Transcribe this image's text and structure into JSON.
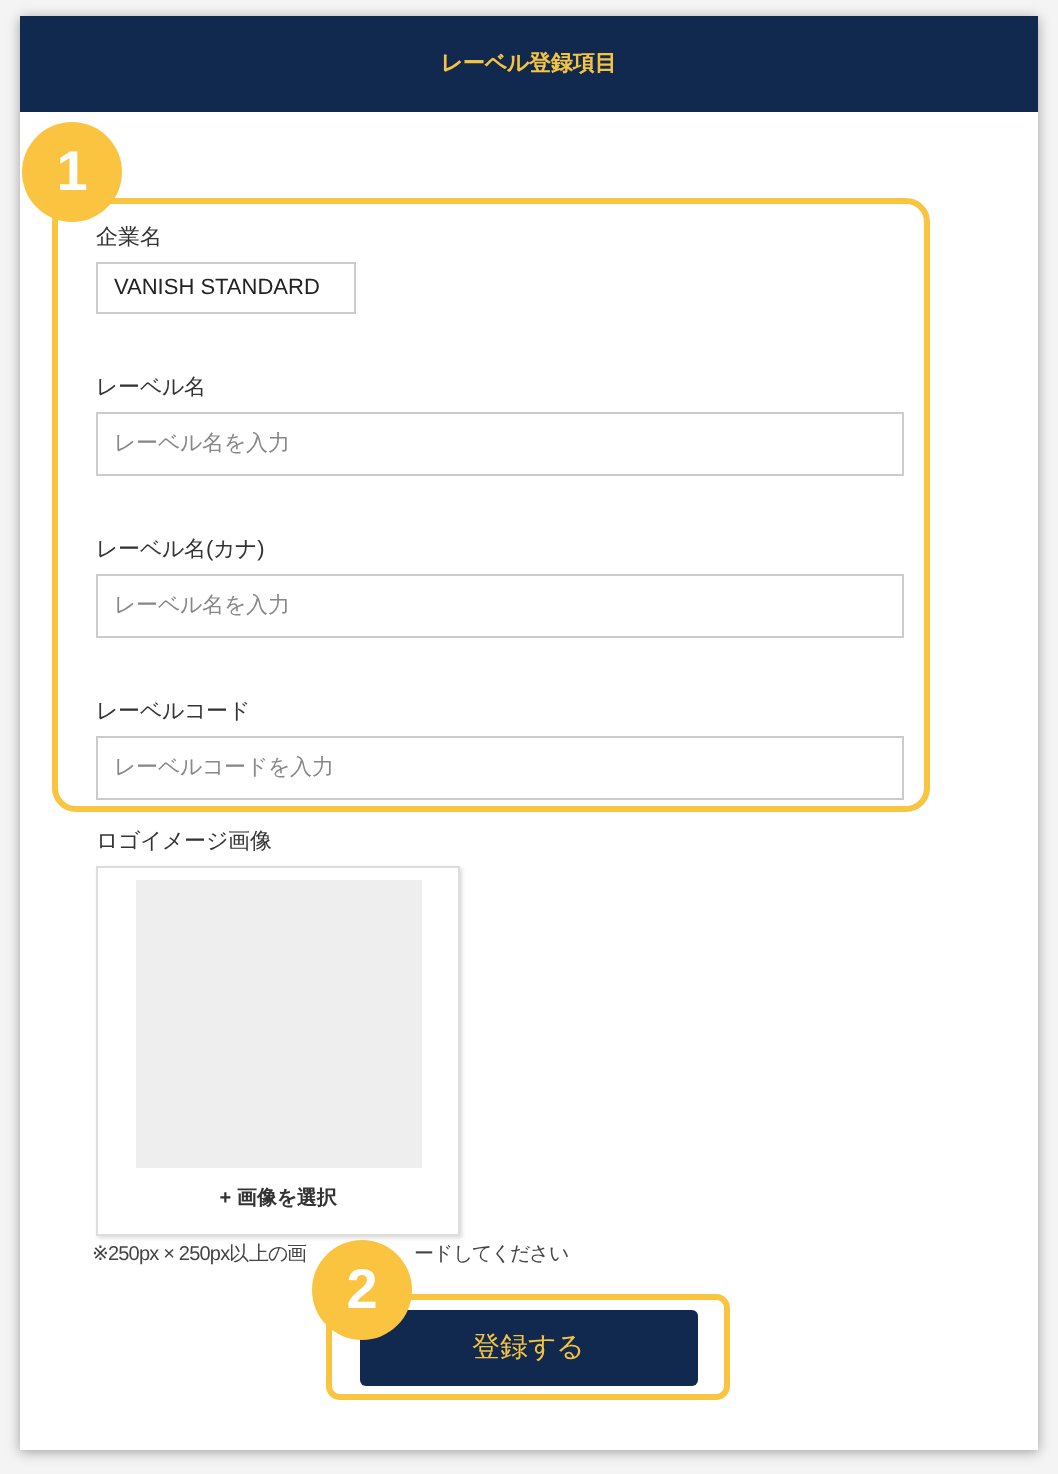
{
  "header": {
    "title": "レーベル登録項目"
  },
  "steps": [
    {
      "number": "1"
    },
    {
      "number": "2"
    }
  ],
  "fields": [
    {
      "label": "企業名",
      "value": "VANISH STANDARD",
      "kind": "short"
    },
    {
      "label": "レーベル名",
      "placeholder": "レーベル名を入力",
      "kind": "wide"
    },
    {
      "label": "レーベル名(カナ)",
      "placeholder": "レーベル名を入力",
      "kind": "wide"
    },
    {
      "label": "レーベルコード",
      "placeholder": "レーベルコードを入力",
      "kind": "wide"
    }
  ],
  "logo": {
    "label": "ロゴイメージ画像",
    "select_button": "+ 画像を選択",
    "note_parts": [
      "※250px × 250px以上の画",
      "ードしてください"
    ]
  },
  "submit_button": "登録する"
}
